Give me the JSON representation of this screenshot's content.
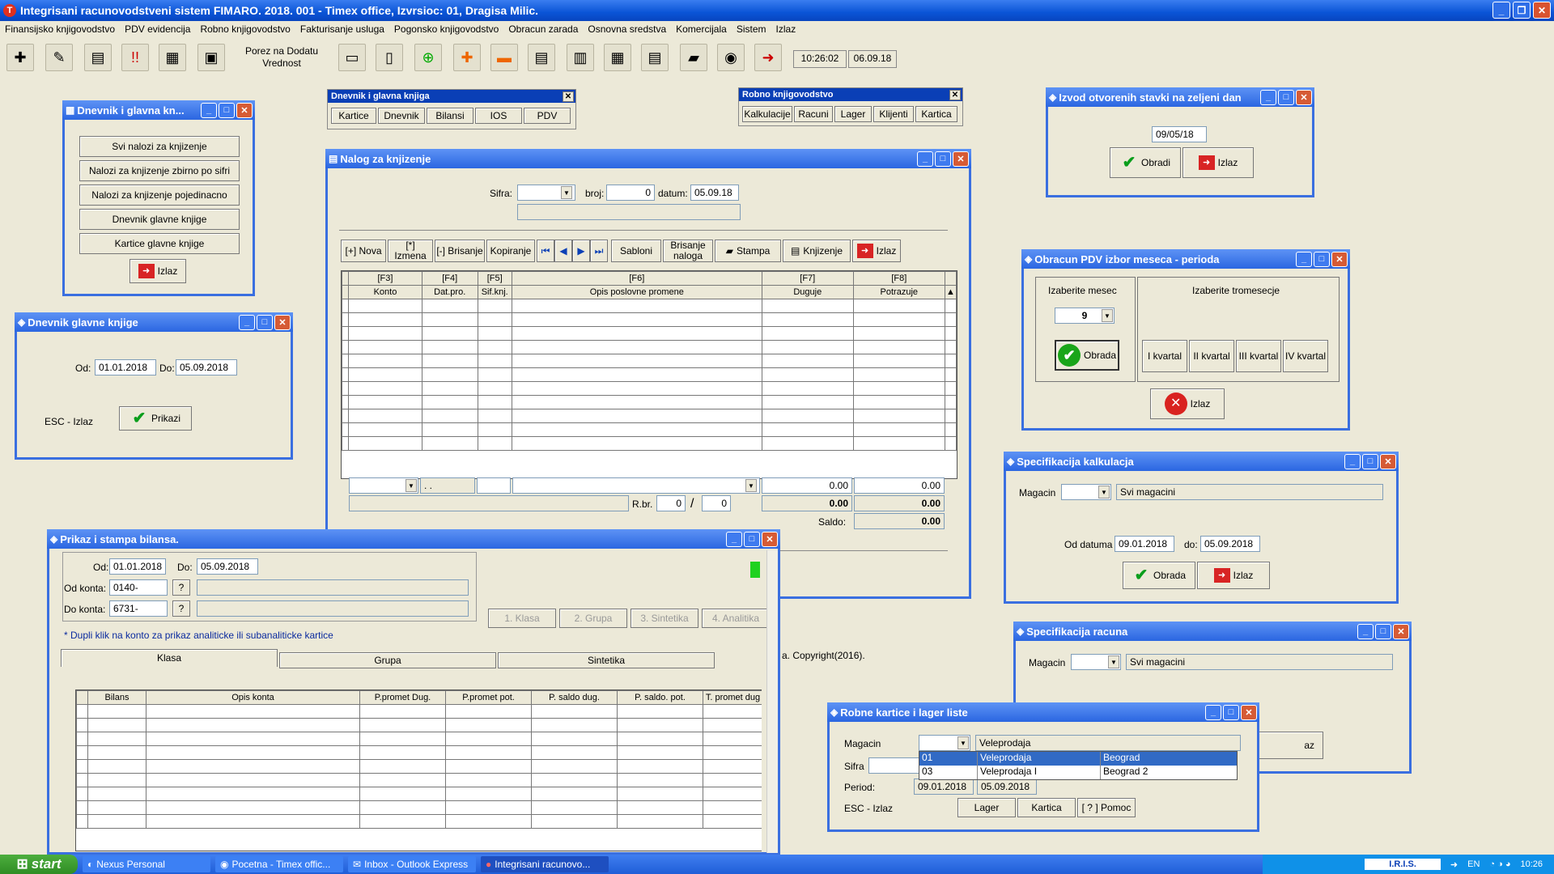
{
  "app": {
    "title": "Integrisani racunovodstveni sistem FIMARO. 2018. 001 - Timex office, Izvrsioc: 01, Dragisa Milic."
  },
  "menu": [
    "Finansijsko knjigovodstvo",
    "PDV evidencija",
    "Robno knjigovodstvo",
    "Fakturisanje usluga",
    "Pogonsko knjigovodstvo",
    "Obracun zarada",
    "Osnovna sredstva",
    "Komercijala",
    "Sistem",
    "Izlaz"
  ],
  "toolbar": {
    "vat_label": "Porez na Dodatu Vrednost",
    "time": "10:26:02",
    "date": "06.09.18"
  },
  "pal_dnevnik": {
    "title": "Dnevnik i glavna knjiga",
    "buttons": [
      "Kartice",
      "Dnevnik",
      "Bilansi",
      "IOS",
      "PDV"
    ]
  },
  "pal_robno": {
    "title": "Robno knjigovodstvo",
    "buttons": [
      "Kalkulacije",
      "Racuni",
      "Lager",
      "Klijenti",
      "Kartica"
    ]
  },
  "win_dgk": {
    "title": "Dnevnik i glavna kn...",
    "items": [
      "Svi nalozi za knjizenje",
      "Nalozi za knjizenje zbirno po sifri",
      "Nalozi za knjizenje pojedinacno",
      "Dnevnik glavne knjige",
      "Kartice glavne knjige"
    ],
    "exit": "Izlaz"
  },
  "win_dnevnik": {
    "title": "Dnevnik glavne knjige",
    "od_label": "Od:",
    "od": "01.01.2018",
    "do_label": "Do:",
    "do": "05.09.2018",
    "esc": "ESC - Izlaz",
    "show": "Prikazi"
  },
  "win_nalog": {
    "title": "Nalog za knjizenje",
    "sifra_label": "Sifra:",
    "broj_label": "broj:",
    "broj": "0",
    "datum_label": "datum:",
    "datum": "05.09.18",
    "buttons": [
      "[+] Nova",
      "[*] Izmena",
      "[-] Brisanje",
      "Kopiranje",
      "Sabloni",
      "Brisanje naloga",
      "Stampa",
      "Knjizenje",
      "Izlaz"
    ],
    "fkeys": [
      "[F3]",
      "[F4]",
      "[F5]",
      "[F6]",
      "[F7]",
      "[F8]"
    ],
    "cols": [
      "Konto",
      "Dat.pro.",
      "Sif.knj.",
      "Opis poslovne promene",
      "Duguje",
      "Potrazuje"
    ],
    "date_placeholder": ". .",
    "sum_dug": "0.00",
    "sum_pot": "0.00",
    "rbr_label": "R.br.",
    "rbr": "0",
    "rbr_total": "0",
    "tot_dug": "0.00",
    "tot_pot": "0.00",
    "saldo_label": "Saldo:",
    "saldo": "0.00"
  },
  "win_bilans": {
    "title": "Prikaz i stampa bilansa.",
    "od_label": "Od:",
    "od": "01.01.2018",
    "do_label": "Do:",
    "do": "05.09.2018",
    "odk_label": "Od konta:",
    "odk": "0140-",
    "dok_label": "Do konta:",
    "dok": "6731-",
    "q": "?",
    "levels": [
      "1. Klasa",
      "2. Grupa",
      "3. Sintetika",
      "4. Analitika"
    ],
    "note": "* Dupli klik na konto za prikaz analiticke ili subanaliticke kartice",
    "tabs": [
      "Klasa",
      "Grupa",
      "Sintetika"
    ],
    "cols": [
      "Bilans",
      "Opis konta",
      "P.promet Dug.",
      "P.promet pot.",
      "P. saldo dug.",
      "P. saldo. pot.",
      "T. promet dug"
    ]
  },
  "copyright": "a. Copyright(2016).",
  "win_izvod": {
    "title": "Izvod otvorenih stavki na zeljeni dan",
    "date": "09/05/18",
    "ok": "Obradi",
    "exit": "Izlaz"
  },
  "win_pdv": {
    "title": "Obracun PDV izbor meseca - perioda",
    "mesec_label": "Izaberite mesec",
    "mesec": "9",
    "ok": "Obrada",
    "kv_label": "Izaberite tromesecje",
    "kvartali": [
      "I kvartal",
      "II kvartal",
      "III kvartal",
      "IV kvartal"
    ],
    "exit": "Izlaz"
  },
  "win_spec_kalk": {
    "title": "Specifikacija kalkulacja",
    "mag_label": "Magacin",
    "mag_text": "Svi magacini",
    "od_label": "Od datuma",
    "od": "09.01.2018",
    "do_label": "do:",
    "do": "05.09.2018",
    "ok": "Obrada",
    "exit": "Izlaz"
  },
  "win_spec_rac": {
    "title": "Specifikacija racuna",
    "mag_label": "Magacin",
    "mag_text": "Svi magacini",
    "exit_partial": "az"
  },
  "win_robne": {
    "title": "Robne kartice i lager liste",
    "mag_label": "Magacin",
    "mag_text": "Veleprodaja",
    "sifra_label": "Sifra",
    "period_label": "Period:",
    "od": "09.01.2018",
    "do": "05.09.2018",
    "esc": "ESC - Izlaz",
    "buttons": [
      "Lager",
      "Kartica",
      "[ ? ] Pomoc"
    ],
    "dropdown": [
      {
        "code": "01",
        "name": "Veleprodaja",
        "city": "Beograd"
      },
      {
        "code": "03",
        "name": "Veleprodaja I",
        "city": "Beograd 2"
      }
    ]
  },
  "taskbar": {
    "start": "start",
    "tasks": [
      "Nexus Personal",
      "Pocetna - Timex offic...",
      "Inbox - Outlook Express",
      "Integrisani racunovo..."
    ],
    "tray_app": "I.R.I.S.",
    "lang": "EN",
    "clock": "10:26"
  }
}
